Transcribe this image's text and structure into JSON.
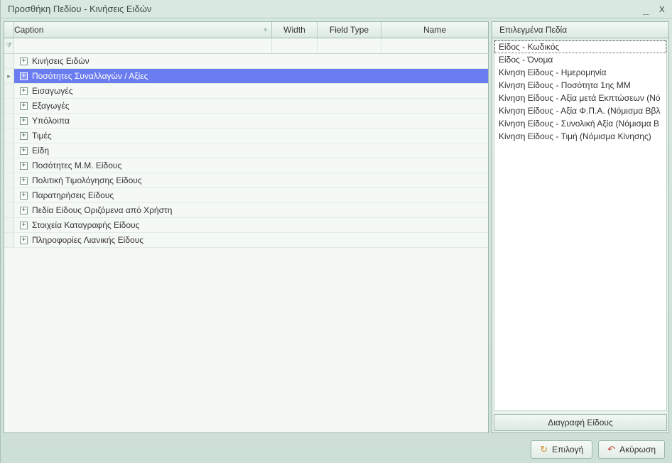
{
  "window": {
    "title": "Προσθήκη Πεδίου - Κινήσεις Ειδών"
  },
  "columns": {
    "caption": "Caption",
    "width": "Width",
    "field_type": "Field Type",
    "name": "Name"
  },
  "tree": {
    "items": [
      {
        "label": "Κινήσεις Ειδών",
        "selected": false
      },
      {
        "label": "Ποσότητες Συναλλαγών / Αξίες",
        "selected": true
      },
      {
        "label": "Εισαγωγές",
        "selected": false
      },
      {
        "label": "Εξαγωγές",
        "selected": false
      },
      {
        "label": "Υπόλοιπα",
        "selected": false
      },
      {
        "label": "Τιμές",
        "selected": false
      },
      {
        "label": "Είδη",
        "selected": false
      },
      {
        "label": "Ποσότητες Μ.Μ. Είδους",
        "selected": false
      },
      {
        "label": "Πολιτική Τιμολόγησης Είδους",
        "selected": false
      },
      {
        "label": "Παρατηρήσεις Είδους",
        "selected": false
      },
      {
        "label": "Πεδία Είδους Οριζόμενα από Χρήστη",
        "selected": false
      },
      {
        "label": "Στοιχεία Καταγραφής Είδους",
        "selected": false
      },
      {
        "label": "Πληροφορίες Λιανικής Είδους",
        "selected": false
      }
    ]
  },
  "right": {
    "header": "Επιλεγμένα Πεδία",
    "items": [
      "Είδος - Κωδικός",
      "Είδος - Όνομα",
      "Κίνηση Είδους - Ημερομηνία",
      "Κίνηση Είδους - Ποσότητα 1ης ΜΜ",
      "Κίνηση Είδους - Αξία μετά Εκπτώσεων (Νό",
      "Κίνηση Είδους - Αξία Φ.Π.Α. (Νόμισμα Ββλ",
      "Κίνηση Είδους - Συνολική Αξία (Νόμισμα Β",
      "Κίνηση Είδους - Τιμή (Νόμισμα Κίνησης)"
    ],
    "delete_label": "Διαγραφή Είδους"
  },
  "footer": {
    "select": "Επιλογή",
    "cancel": "Ακύρωση"
  }
}
